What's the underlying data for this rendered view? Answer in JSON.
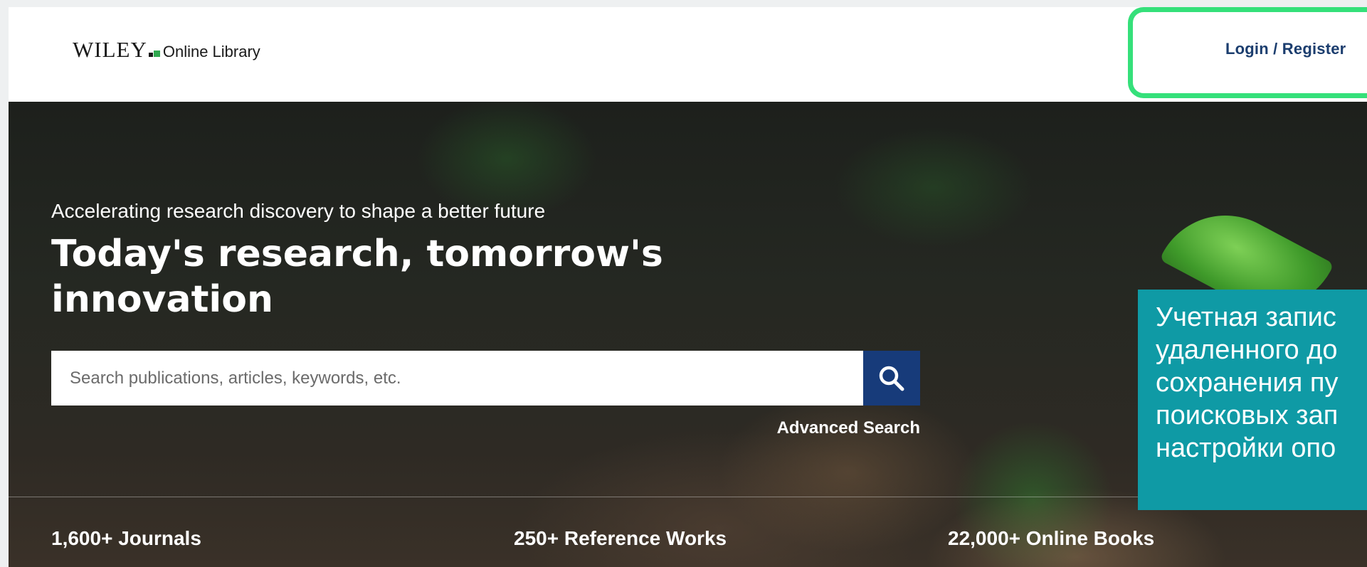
{
  "header": {
    "logo_wordmark": "WILEY",
    "logo_sub": "Online Library",
    "login_label": "Login / Register"
  },
  "hero": {
    "tagline": "Accelerating research discovery to shape a better future",
    "headline": "Today's research, tomorrow's innovation",
    "search_placeholder": "Search publications, articles, keywords, etc.",
    "search_icon": "search-icon",
    "advanced_search": "Advanced Search"
  },
  "stats": [
    {
      "label": "1,600+ Journals"
    },
    {
      "label": "250+ Reference Works"
    },
    {
      "label": "22,000+ Online Books"
    }
  ],
  "callout": {
    "lines": [
      "Учетная запис",
      "удаленного до",
      "сохранения пу",
      "поисковых зап",
      "настройки опо"
    ]
  },
  "colors": {
    "brand_navy": "#173b7a",
    "login_highlight": "#35e07a",
    "callout_bg": "#0f9aa5",
    "logo_green": "#2fa84f"
  }
}
